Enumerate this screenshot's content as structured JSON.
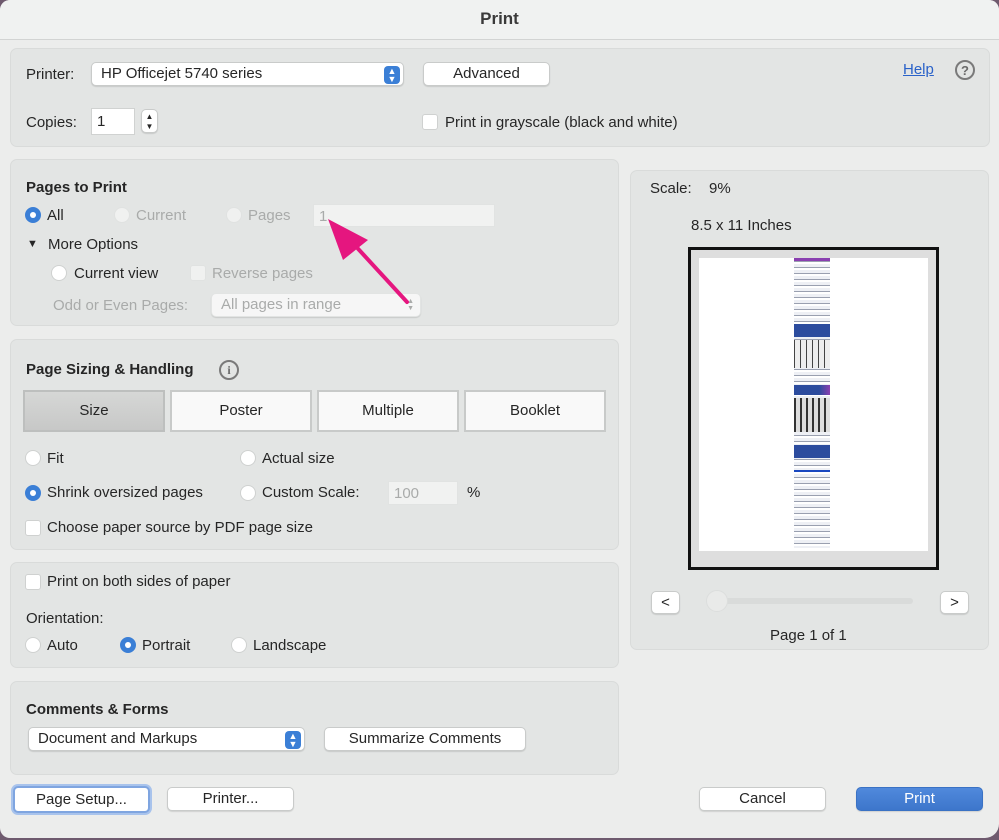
{
  "window": {
    "title": "Print"
  },
  "printer_section": {
    "printer_label": "Printer:",
    "printer_value": "HP Officejet 5740 series",
    "advanced_label": "Advanced",
    "help_label": "Help",
    "help_icon": "question-circle-icon",
    "copies_label": "Copies:",
    "copies_value": "1",
    "grayscale_label": "Print in grayscale (black and white)",
    "grayscale_checked": false
  },
  "pages_to_print": {
    "heading": "Pages to Print",
    "all_label": "All",
    "current_label": "Current",
    "pages_label": "Pages",
    "pages_value": "1",
    "selected": "All",
    "more_options_label": "More Options",
    "current_view_label": "Current view",
    "reverse_pages_label": "Reverse pages",
    "odd_even_label": "Odd or Even Pages:",
    "odd_even_value": "All pages in range"
  },
  "annotation": {
    "arrow_color": "#e5167f"
  },
  "page_sizing": {
    "heading": "Page Sizing & Handling",
    "info_icon": "info-icon",
    "tabs": [
      "Size",
      "Poster",
      "Multiple",
      "Booklet"
    ],
    "active_tab": "Size",
    "fit_label": "Fit",
    "actual_size_label": "Actual size",
    "shrink_label": "Shrink oversized pages",
    "custom_scale_label": "Custom Scale:",
    "custom_scale_value": "100",
    "percent_label": "%",
    "selected": "Shrink oversized pages",
    "paper_source_label": "Choose paper source by PDF page size"
  },
  "orientation_section": {
    "both_sides_label": "Print on both sides of paper",
    "orientation_label": "Orientation:",
    "auto_label": "Auto",
    "portrait_label": "Portrait",
    "landscape_label": "Landscape",
    "selected": "Portrait"
  },
  "comments_forms": {
    "heading": "Comments & Forms",
    "select_value": "Document and Markups",
    "summarize_label": "Summarize Comments"
  },
  "preview": {
    "scale_label": "Scale:",
    "scale_value": "9%",
    "paper_size": "8.5 x 11 Inches",
    "prev_label": "<",
    "next_label": ">",
    "page_indicator": "Page 1 of 1",
    "slider_position": 0
  },
  "footer": {
    "page_setup_label": "Page Setup...",
    "printer_label": "Printer...",
    "cancel_label": "Cancel",
    "print_label": "Print",
    "accent": "#3f7bd0"
  }
}
